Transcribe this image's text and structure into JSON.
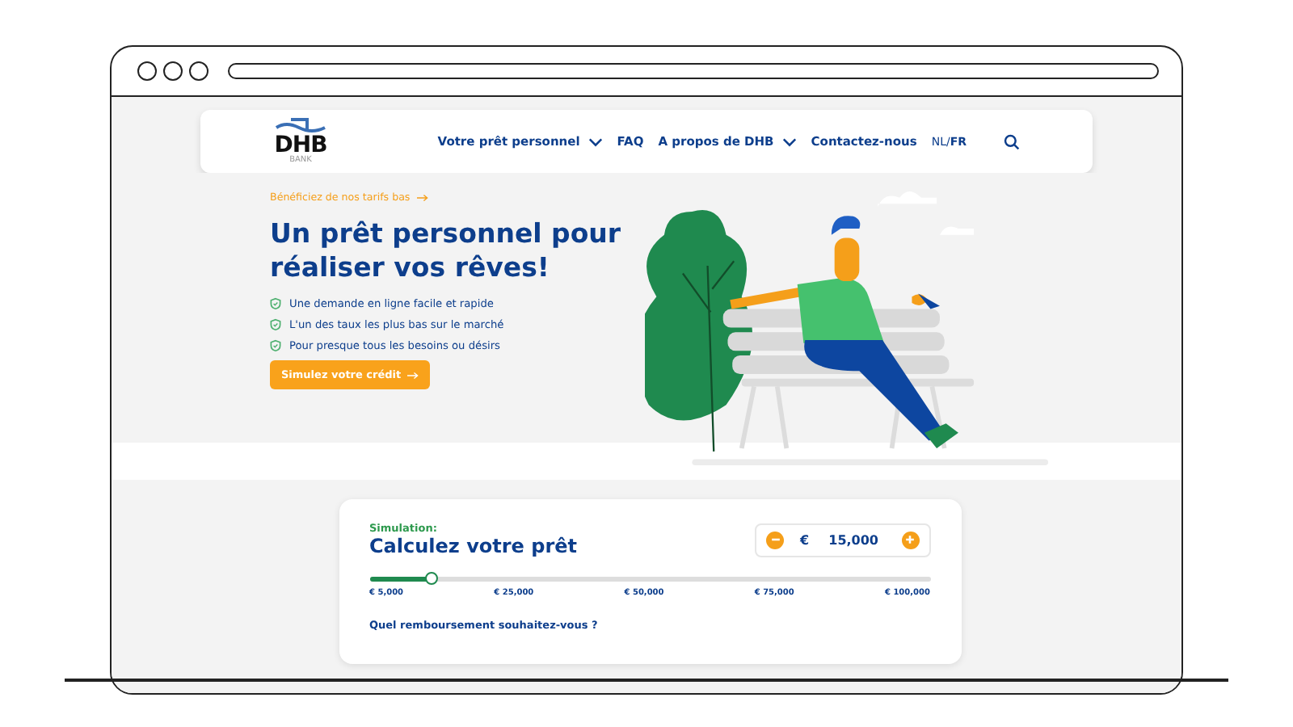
{
  "logo": {
    "text": "DHB",
    "subtext": "BANK"
  },
  "nav": {
    "items": [
      {
        "label": "Votre prêt personnel",
        "dropdown": true
      },
      {
        "label": "FAQ",
        "dropdown": false
      },
      {
        "label": "A propos de DHB",
        "dropdown": true
      },
      {
        "label": "Contactez-nous",
        "dropdown": false
      }
    ],
    "languages": [
      {
        "label": "NL",
        "selected": false
      },
      {
        "label": "FR",
        "selected": true
      }
    ],
    "lang_separator": "/"
  },
  "hero": {
    "eyebrow": "Bénéficiez de nos tarifs bas",
    "title": "Un prêt personnel pour réaliser vos rêves!",
    "benefits": [
      "Une demande en ligne facile et rapide",
      "L'un des taux les plus bas sur le marché",
      "Pour presque tous les besoins ou désirs"
    ],
    "cta": "Simulez votre crédit"
  },
  "simulation": {
    "label": "Simulation:",
    "title": "Calculez votre prêt",
    "currency": "€",
    "amount": "15,000",
    "slider": {
      "level": 0.11,
      "ticks": [
        "€ 5,000",
        "€ 25,000",
        "€ 50,000",
        "€ 75,000",
        "€ 100,000"
      ]
    },
    "question": "Quel remboursement souhaitez-vous ?"
  }
}
